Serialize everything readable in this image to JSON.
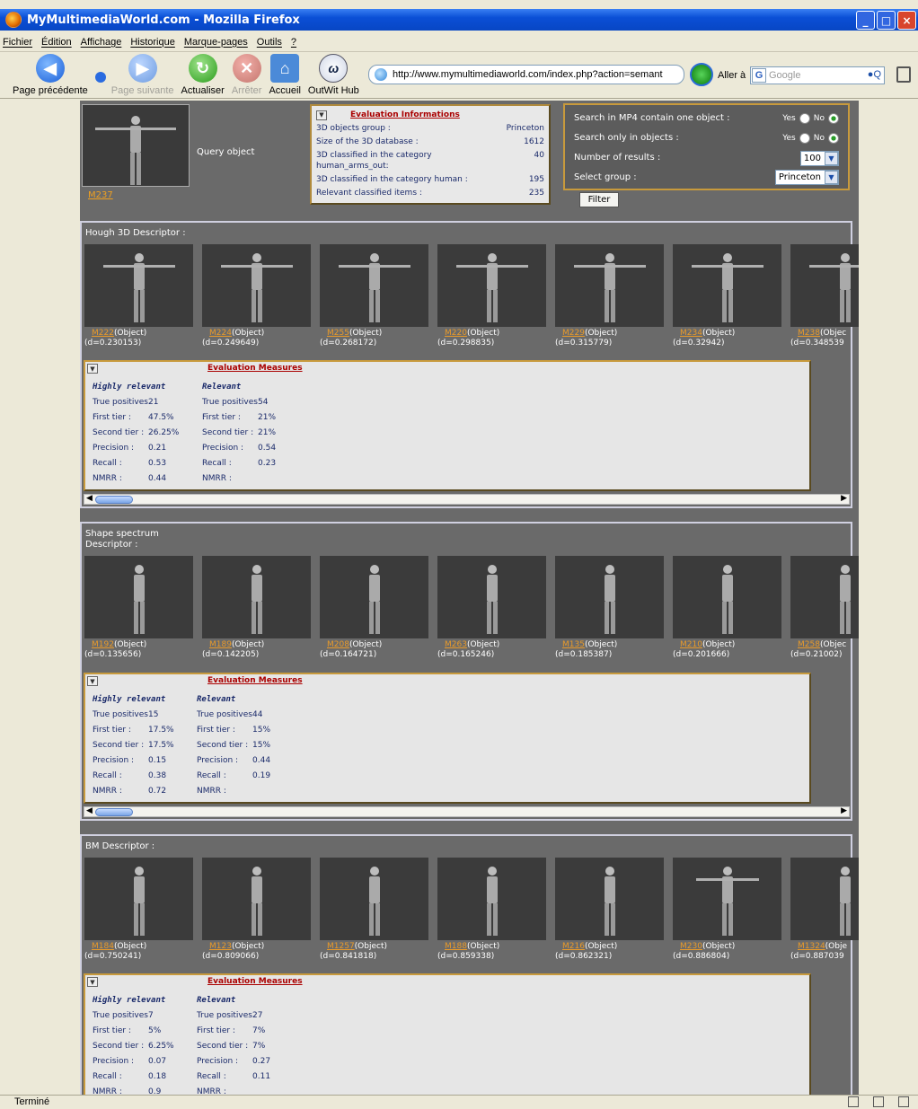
{
  "window": {
    "title": "MyMultimediaWorld.com - Mozilla Firefox"
  },
  "menu": [
    "Fichier",
    "Édition",
    "Affichage",
    "Historique",
    "Marque-pages",
    "Outils",
    "?"
  ],
  "nav": {
    "back": "Page précédente",
    "forward": "Page suivante",
    "reload": "Actualiser",
    "stop": "Arrêter",
    "home": "Accueil",
    "outwit": "OutWit Hub",
    "url": "http://www.mymultimediaworld.com/index.php?action=semant",
    "go": "Aller à",
    "search_placeholder": "Google"
  },
  "query": {
    "label": "Query object",
    "id": "M237"
  },
  "eval_info": {
    "title": "Evaluation Informations",
    "rows": [
      {
        "k": "3D objects group :",
        "v": "Princeton"
      },
      {
        "k": "Size of the 3D database :",
        "v": "1612"
      },
      {
        "k": "3D classified in the category human_arms_out:",
        "v": "40"
      },
      {
        "k": "3D classified in the category human :",
        "v": "195"
      },
      {
        "k": "Relevant classified items :",
        "v": "235"
      }
    ]
  },
  "filter": {
    "mp4_label": "Search in MP4 contain one object :",
    "objects_label": "Search only in objects :",
    "yes": "Yes",
    "no": "No",
    "results_label": "Number of results :",
    "results_value": "100",
    "group_label": "Select group :",
    "group_value": "Princeton",
    "button": "Filter"
  },
  "sections": [
    {
      "title": "Hough 3D Descriptor :",
      "items": [
        {
          "id": "M222",
          "type": "(Object)",
          "d": "(d=0.230153)"
        },
        {
          "id": "M224",
          "type": "(Object)",
          "d": "(d=0.249649)"
        },
        {
          "id": "M255",
          "type": "(Object)",
          "d": "(d=0.268172)"
        },
        {
          "id": "M220",
          "type": "(Object)",
          "d": "(d=0.298835)"
        },
        {
          "id": "M229",
          "type": "(Object)",
          "d": "(d=0.315779)"
        },
        {
          "id": "M234",
          "type": "(Object)",
          "d": "(d=0.32942)"
        },
        {
          "id": "M238",
          "type": "(Objec",
          "d": "(d=0.348539"
        }
      ],
      "measures": {
        "title": "Evaluation Measures",
        "hr_head": "Highly relevant",
        "r_head": "Relevant",
        "hr": [
          [
            "True positives :",
            "21"
          ],
          [
            "First tier :",
            "47.5%"
          ],
          [
            "Second tier :",
            "26.25%"
          ],
          [
            "Precision :",
            "0.21"
          ],
          [
            "Recall :",
            "0.53"
          ],
          [
            "NMRR :",
            "0.44"
          ]
        ],
        "r": [
          [
            "True positives :",
            "54"
          ],
          [
            "First tier :",
            "21%"
          ],
          [
            "Second tier :",
            "21%"
          ],
          [
            "Precision :",
            "0.54"
          ],
          [
            "Recall :",
            "0.23"
          ],
          [
            "NMRR :",
            ""
          ]
        ]
      }
    },
    {
      "title": "Shape spectrum Descriptor :",
      "items": [
        {
          "id": "M192",
          "type": "(Object)",
          "d": "(d=0.135656)"
        },
        {
          "id": "M189",
          "type": "(Object)",
          "d": "(d=0.142205)"
        },
        {
          "id": "M208",
          "type": "(Object)",
          "d": "(d=0.164721)"
        },
        {
          "id": "M263",
          "type": "(Object)",
          "d": "(d=0.165246)"
        },
        {
          "id": "M135",
          "type": "(Object)",
          "d": "(d=0.185387)"
        },
        {
          "id": "M210",
          "type": "(Object)",
          "d": "(d=0.201666)"
        },
        {
          "id": "M258",
          "type": "(Objec",
          "d": "(d=0.21002)"
        }
      ],
      "measures": {
        "title": "Evaluation Measures",
        "hr_head": "Highly relevant",
        "r_head": "Relevant",
        "hr": [
          [
            "True positives :",
            "15"
          ],
          [
            "First tier :",
            "17.5%"
          ],
          [
            "Second tier :",
            "17.5%"
          ],
          [
            "Precision :",
            "0.15"
          ],
          [
            "Recall :",
            "0.38"
          ],
          [
            "NMRR :",
            "0.72"
          ]
        ],
        "r": [
          [
            "True positives :",
            "44"
          ],
          [
            "First tier :",
            "15%"
          ],
          [
            "Second tier :",
            "15%"
          ],
          [
            "Precision :",
            "0.44"
          ],
          [
            "Recall :",
            "0.19"
          ],
          [
            "NMRR :",
            ""
          ]
        ]
      }
    },
    {
      "title": "BM Descriptor :",
      "items": [
        {
          "id": "M184",
          "type": "(Object)",
          "d": "(d=0.750241)"
        },
        {
          "id": "M123",
          "type": "(Object)",
          "d": "(d=0.809066)"
        },
        {
          "id": "M1257",
          "type": "(Object)",
          "d": "(d=0.841818)"
        },
        {
          "id": "M188",
          "type": "(Object)",
          "d": "(d=0.859338)"
        },
        {
          "id": "M216",
          "type": "(Object)",
          "d": "(d=0.862321)"
        },
        {
          "id": "M230",
          "type": "(Object)",
          "d": "(d=0.886804)"
        },
        {
          "id": "M1324",
          "type": "(Obje",
          "d": "(d=0.887039"
        }
      ],
      "measures": {
        "title": "Evaluation Measures",
        "hr_head": "Highly relevant",
        "r_head": "Relevant",
        "hr": [
          [
            "True positives :",
            "7"
          ],
          [
            "First tier :",
            "5%"
          ],
          [
            "Second tier :",
            "6.25%"
          ],
          [
            "Precision :",
            "0.07"
          ],
          [
            "Recall :",
            "0.18"
          ],
          [
            "NMRR :",
            "0.9"
          ]
        ],
        "r": [
          [
            "True positives :",
            "27"
          ],
          [
            "First tier :",
            "7%"
          ],
          [
            "Second tier :",
            "7%"
          ],
          [
            "Precision :",
            "0.27"
          ],
          [
            "Recall :",
            "0.11"
          ],
          [
            "NMRR :",
            ""
          ]
        ]
      }
    }
  ],
  "status": {
    "text": "Terminé"
  }
}
